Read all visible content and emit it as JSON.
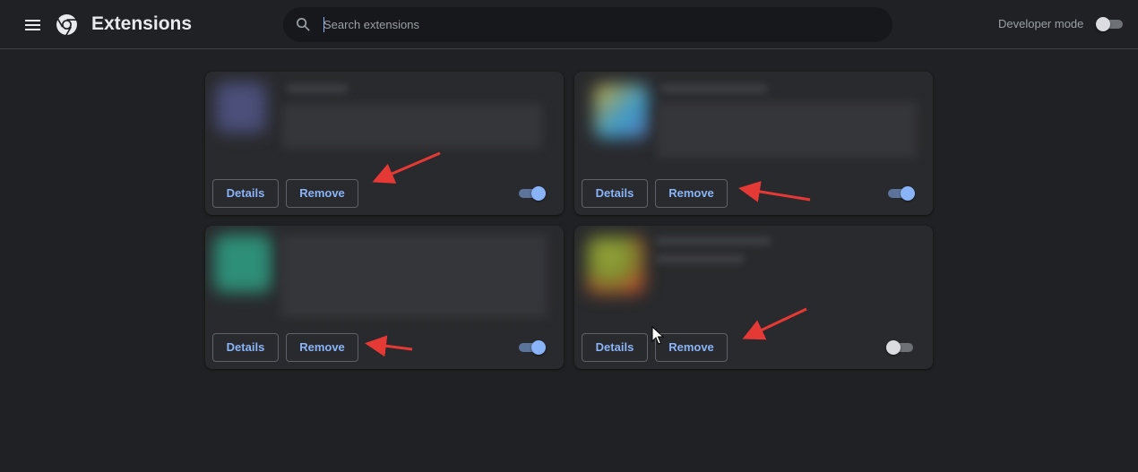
{
  "header": {
    "title": "Extensions",
    "menu_icon": "hamburger-menu-icon",
    "logo_icon": "chrome-logo-icon",
    "search": {
      "placeholder": "Search extensions",
      "value": "",
      "icon": "search-icon"
    },
    "developer_mode": {
      "label": "Developer mode",
      "enabled": false
    }
  },
  "extensions": [
    {
      "details_label": "Details",
      "remove_label": "Remove",
      "enabled": true,
      "icon_color": "#4b4f7a"
    },
    {
      "details_label": "Details",
      "remove_label": "Remove",
      "enabled": true,
      "icon_color": "#4f8fc7"
    },
    {
      "details_label": "Details",
      "remove_label": "Remove",
      "enabled": true,
      "icon_color": "#2e8f78"
    },
    {
      "details_label": "Details",
      "remove_label": "Remove",
      "enabled": false,
      "icon_color": "#9aa83c"
    }
  ],
  "colors": {
    "background": "#202124",
    "card": "#292a2d",
    "accent": "#8ab4f8",
    "annotation_arrow": "#e53935"
  }
}
